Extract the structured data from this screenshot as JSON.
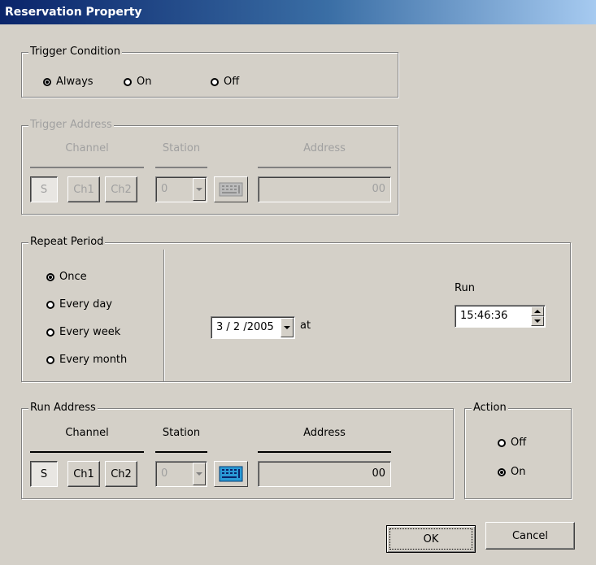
{
  "window": {
    "title": "Reservation Property"
  },
  "trigger_condition": {
    "label": "Trigger Condition",
    "options": [
      "Always",
      "On",
      "Off"
    ],
    "selected": "Always"
  },
  "trigger_address": {
    "label": "Trigger Address",
    "channel_header": "Channel",
    "station_header": "Station",
    "address_header": "Address",
    "channel_buttons": [
      "S",
      "Ch1",
      "Ch2"
    ],
    "station_value": "0",
    "address_value": "00"
  },
  "repeat_period": {
    "label": "Repeat Period",
    "options": [
      "Once",
      "Every day",
      "Every week",
      "Every month"
    ],
    "selected": "Once",
    "date_value": "3 / 2 /2005",
    "at_label": "at",
    "run_label": "Run",
    "run_time": "15:46:36"
  },
  "run_address": {
    "label": "Run Address",
    "channel_header": "Channel",
    "station_header": "Station",
    "address_header": "Address",
    "channel_buttons": [
      "S",
      "Ch1",
      "Ch2"
    ],
    "station_value": "0",
    "address_value": "00"
  },
  "action": {
    "label": "Action",
    "options": [
      "Off",
      "On"
    ],
    "selected": "On"
  },
  "buttons": {
    "ok": "OK",
    "cancel": "Cancel"
  },
  "icons": {
    "keypad": "keypad-icon"
  }
}
